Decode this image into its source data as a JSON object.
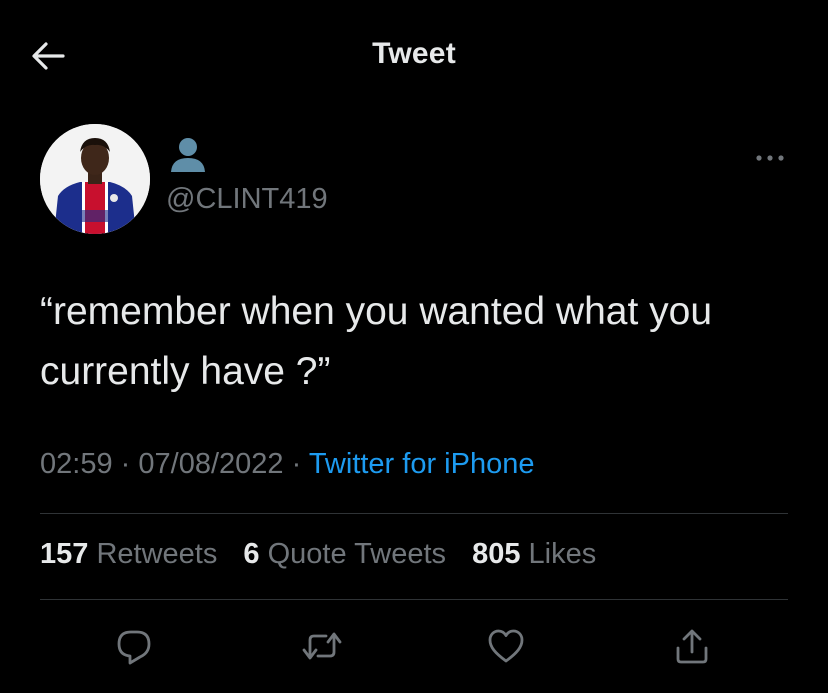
{
  "header": {
    "title": "Tweet",
    "back_icon": "arrow-left-icon"
  },
  "author": {
    "avatar_icon": "profile-photo",
    "name_emoji": "bust-in-silhouette-emoji",
    "handle": "@CLINT419",
    "more_icon": "more-horizontal-icon"
  },
  "tweet": {
    "text": "“remember when you wanted what you currently have ?”",
    "time": "02:59",
    "date": "07/08/2022",
    "separator": "·",
    "source": "Twitter for iPhone"
  },
  "stats": {
    "retweets_count": "157",
    "retweets_label": "Retweets",
    "quotes_count": "6",
    "quotes_label": "Quote Tweets",
    "likes_count": "805",
    "likes_label": "Likes"
  },
  "actions": {
    "reply_icon": "reply-icon",
    "retweet_icon": "retweet-icon",
    "like_icon": "heart-icon",
    "share_icon": "share-icon"
  },
  "colors": {
    "background": "#000000",
    "text": "#e7e9ea",
    "secondary": "#71767b",
    "link": "#1d9bf0",
    "divider": "#2f3336"
  }
}
